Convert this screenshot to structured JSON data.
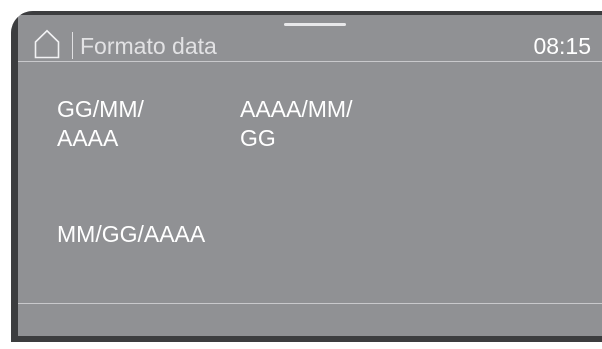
{
  "header": {
    "home_icon": "home-icon",
    "title": "Formato data",
    "time": "08:15"
  },
  "options": [
    {
      "label": "GG/MM/\nAAAA"
    },
    {
      "label": "AAAA/MM/\nGG"
    },
    {
      "label": "MM/GG/AAAA"
    }
  ],
  "colors": {
    "screen_background": "#909194",
    "bezel": "#3c3d3f",
    "text": "#ffffff",
    "divider": "#c9c9cc"
  }
}
